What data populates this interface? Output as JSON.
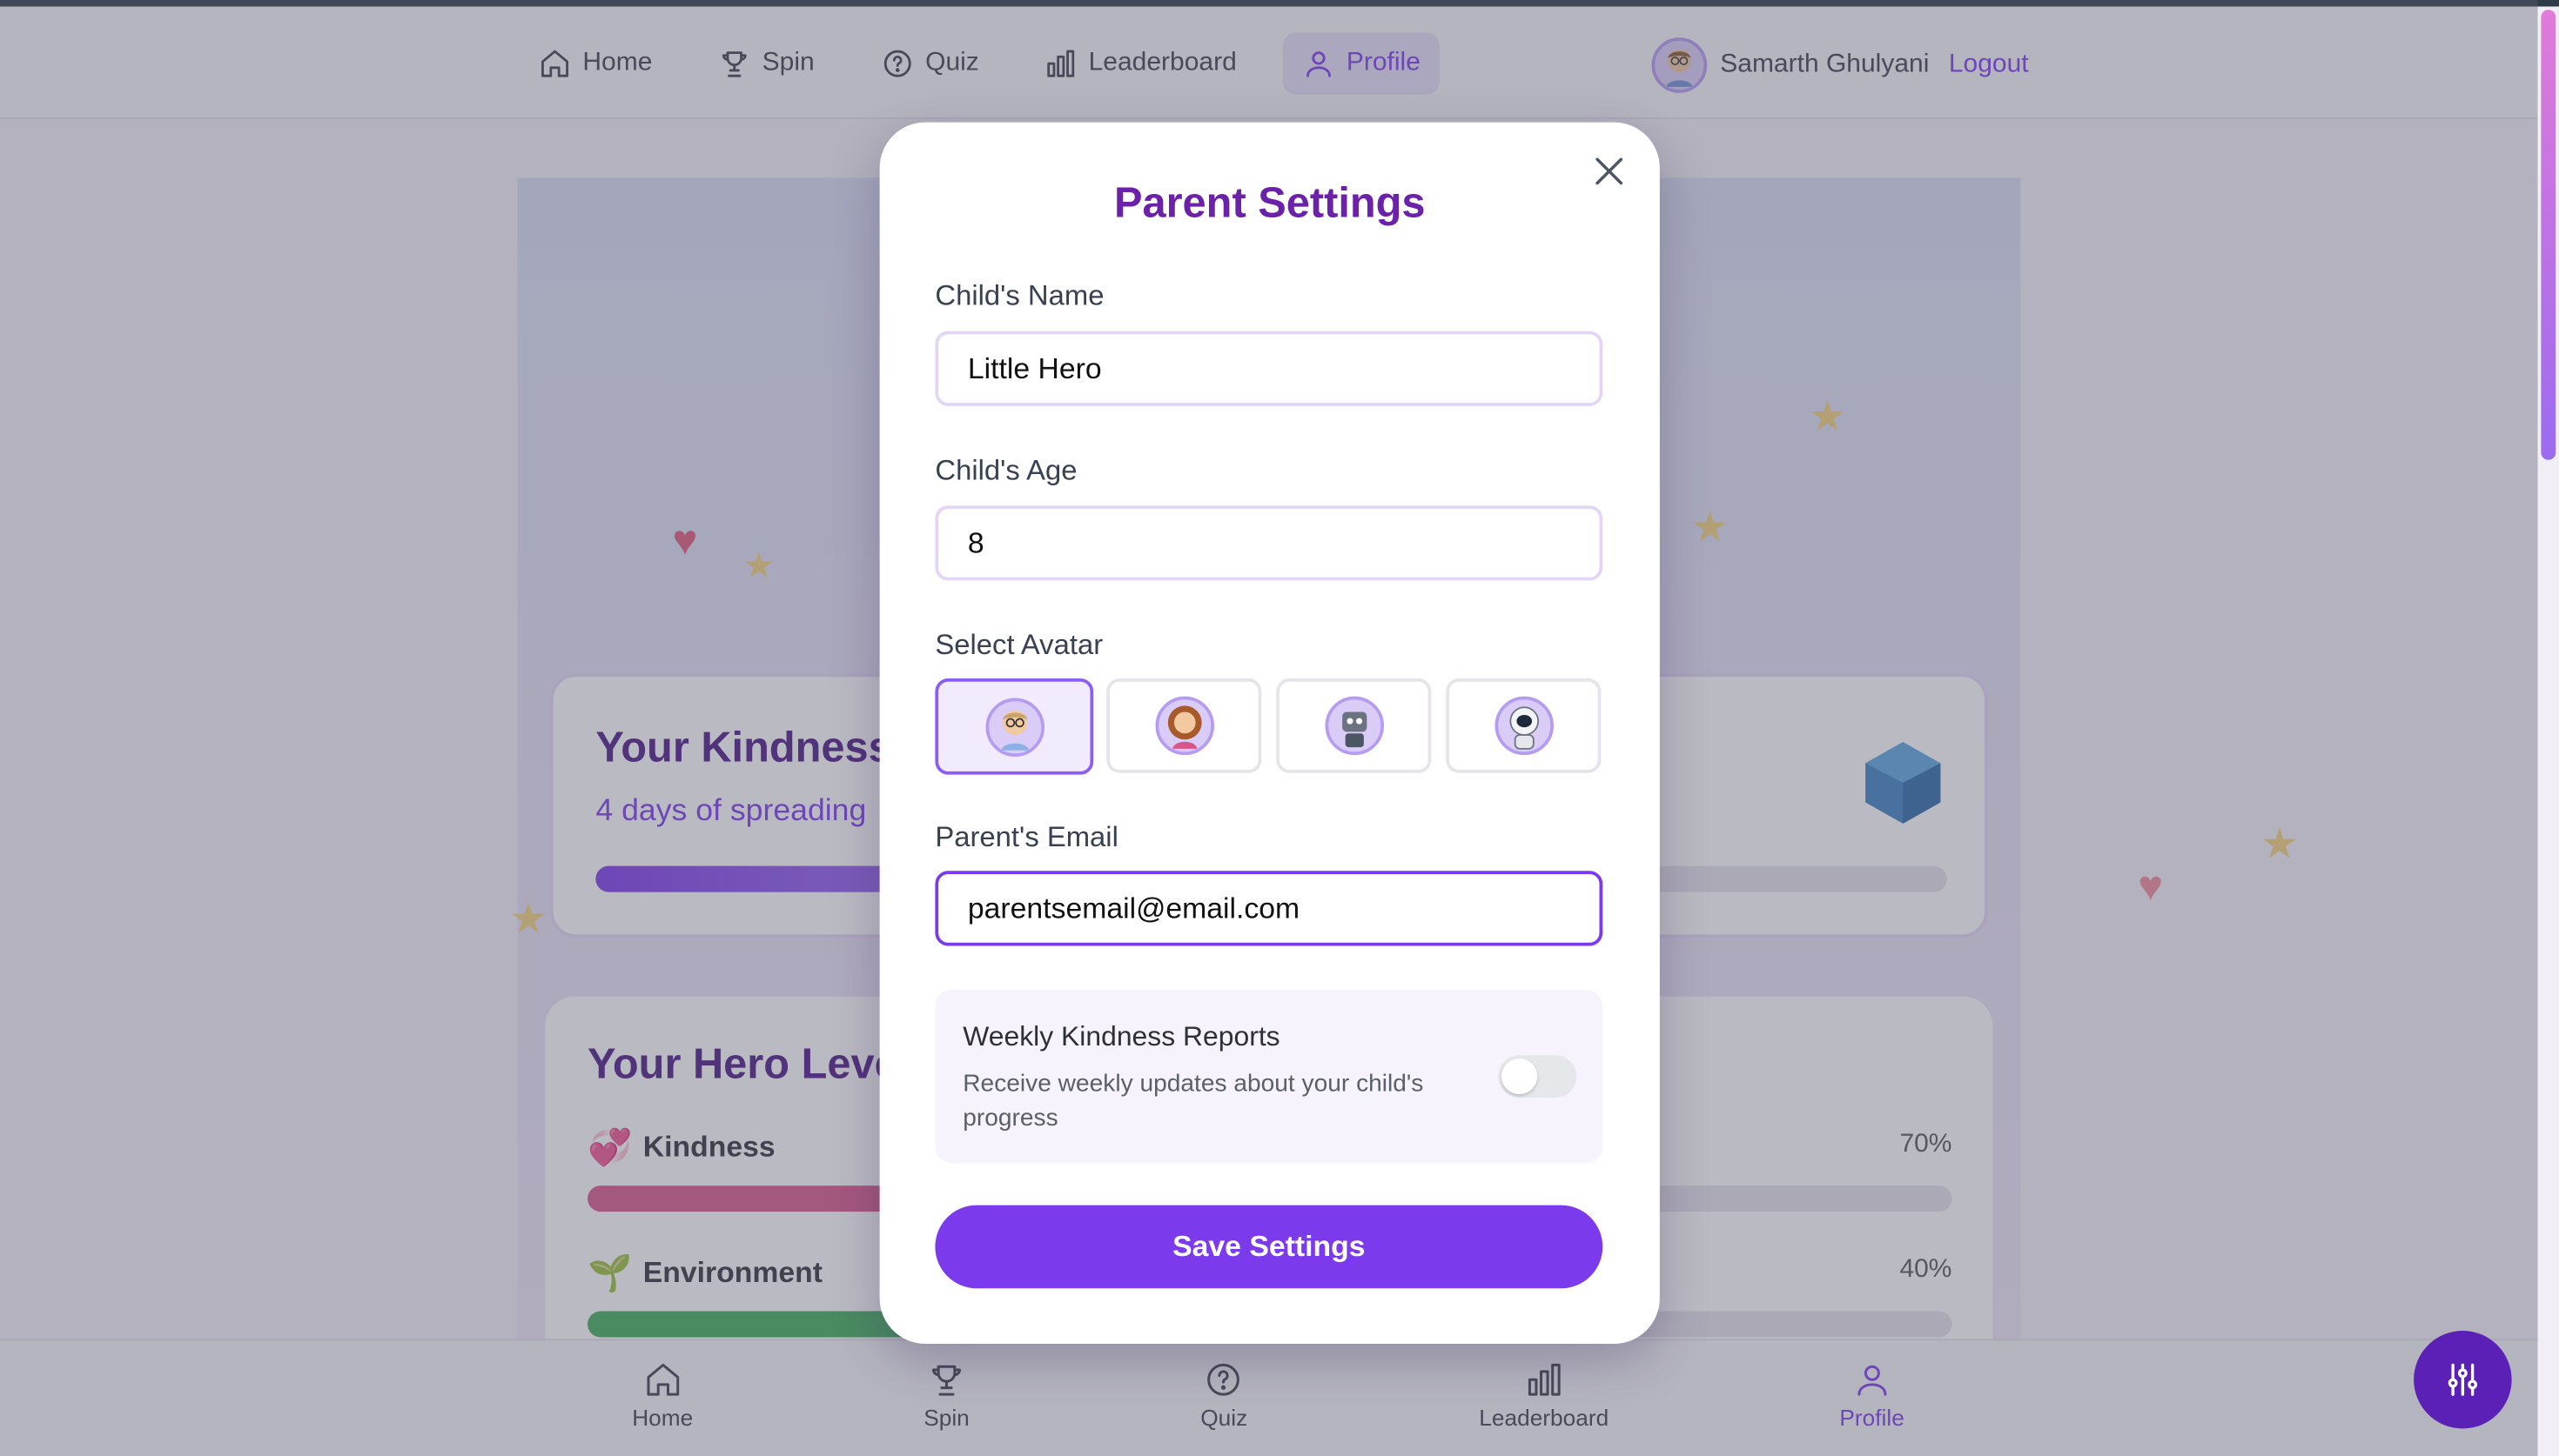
{
  "topnav": {
    "items": [
      {
        "label": "Home",
        "icon": "home-icon"
      },
      {
        "label": "Spin",
        "icon": "trophy-icon"
      },
      {
        "label": "Quiz",
        "icon": "help-circle-icon"
      },
      {
        "label": "Leaderboard",
        "icon": "bar-chart-icon"
      },
      {
        "label": "Profile",
        "icon": "user-icon",
        "active": true
      }
    ],
    "user_name": "Samarth Ghulyani",
    "logout_label": "Logout"
  },
  "background": {
    "streak": {
      "title": "Your Kindness",
      "subtitle": "4 days of spreading"
    },
    "levels": {
      "title": "Your Hero Leve",
      "stats": [
        {
          "emoji": "💞",
          "label": "Kindness",
          "percent_label": "70%",
          "value": 0.7,
          "color": "#d9568b"
        },
        {
          "emoji": "🌱",
          "label": "Environment",
          "percent_label": "40%",
          "value": 0.4,
          "color": "#3fae5a"
        }
      ]
    }
  },
  "modal": {
    "title": "Parent Settings",
    "child_name_label": "Child's Name",
    "child_name_value": "Little Hero",
    "child_age_label": "Child's Age",
    "child_age_value": "8",
    "avatar_label": "Select Avatar",
    "avatars": [
      "boy-glasses-avatar",
      "girl-curly-avatar",
      "robot-avatar",
      "astronaut-avatar"
    ],
    "selected_avatar_index": 0,
    "parent_email_label": "Parent's Email",
    "parent_email_value": "parentsemail@email.com",
    "report_title": "Weekly Kindness Reports",
    "report_desc": "Receive weekly updates about your child's progress",
    "report_enabled": false,
    "save_label": "Save Settings"
  },
  "bottomnav": {
    "items": [
      {
        "label": "Home",
        "icon": "home-icon"
      },
      {
        "label": "Spin",
        "icon": "trophy-icon"
      },
      {
        "label": "Quiz",
        "icon": "help-circle-icon"
      },
      {
        "label": "Leaderboard",
        "icon": "bar-chart-icon"
      },
      {
        "label": "Profile",
        "icon": "user-icon",
        "active": true
      }
    ]
  },
  "colors": {
    "accent": "#7c3aed",
    "title_purple": "#6b21a8",
    "dark_purple": "#4b1785"
  }
}
